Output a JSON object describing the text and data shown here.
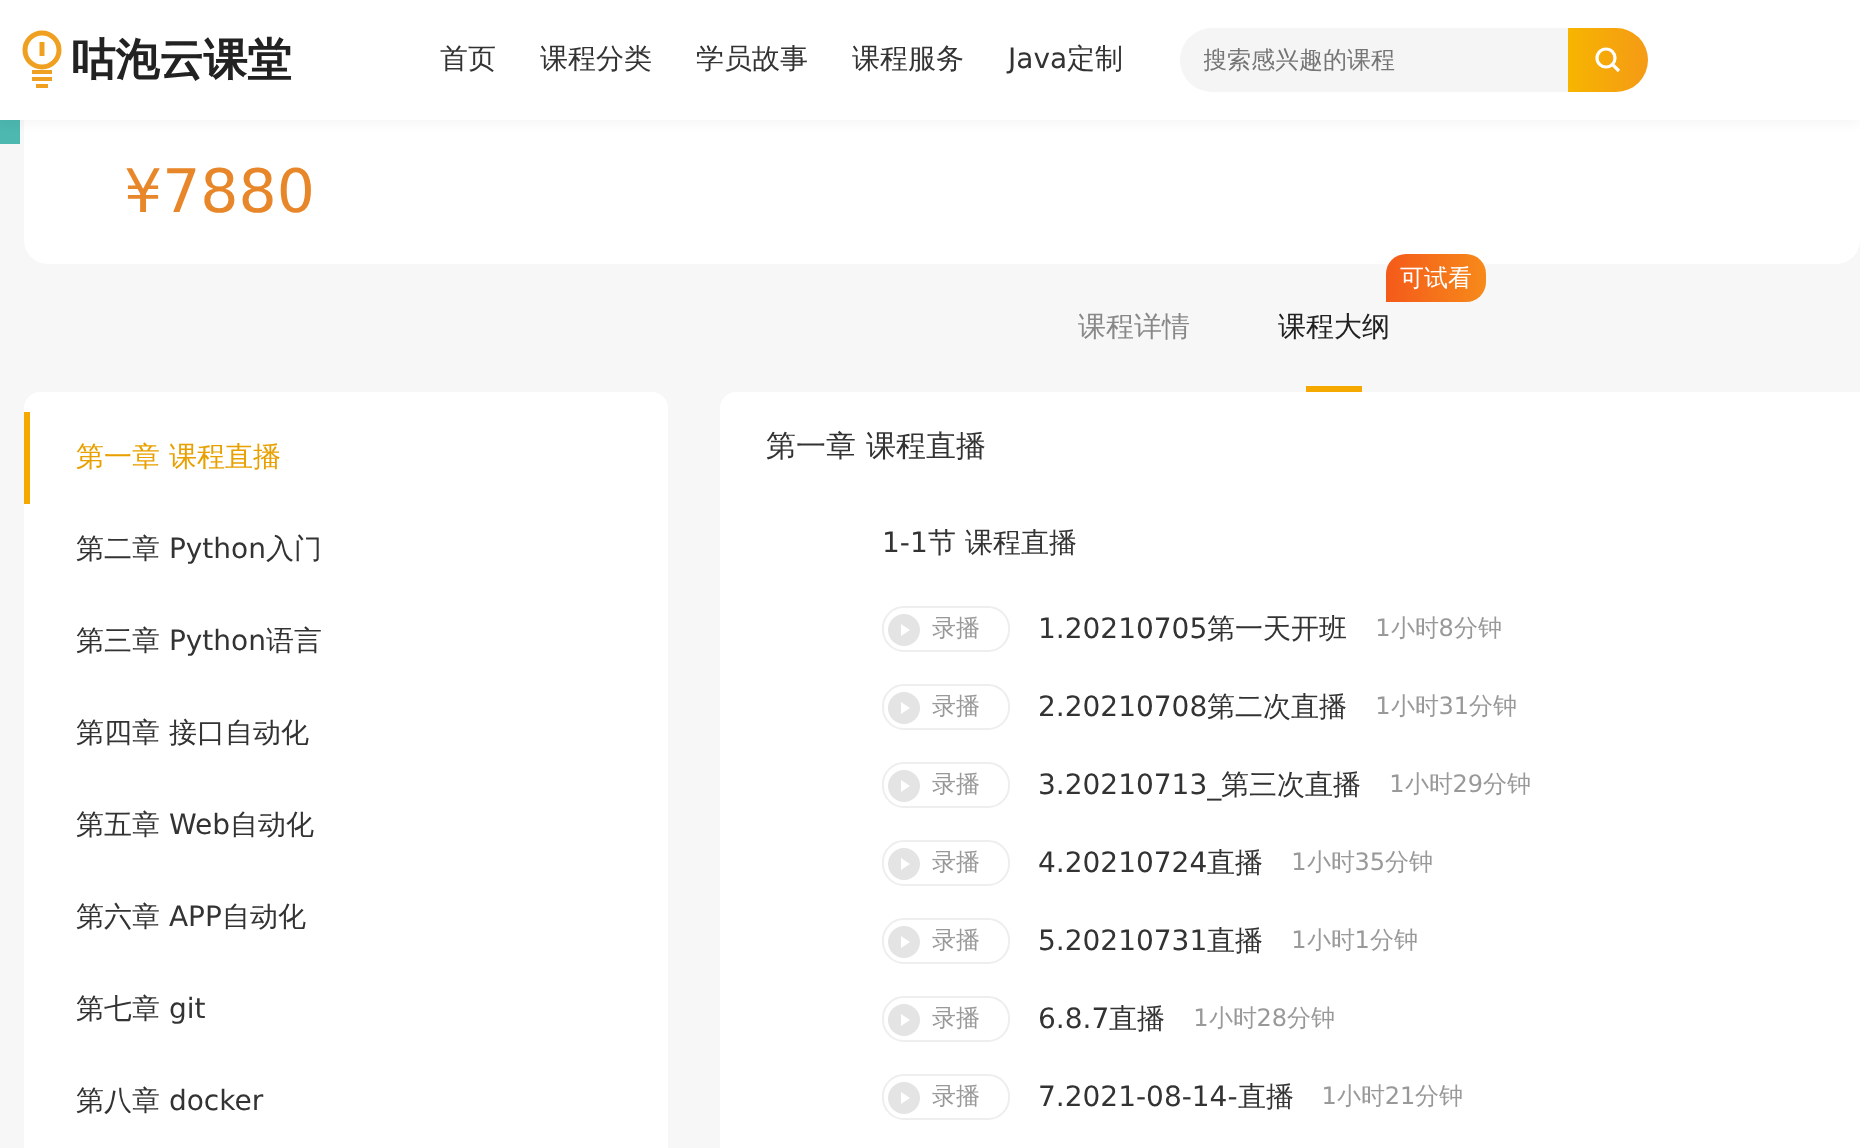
{
  "header": {
    "logo": "咕泡云课堂",
    "nav": [
      {
        "label": "首页"
      },
      {
        "label": "课程分类"
      },
      {
        "label": "学员故事"
      },
      {
        "label": "课程服务"
      },
      {
        "label": "Java定制"
      }
    ],
    "search": {
      "placeholder": "搜索感兴趣的课程"
    }
  },
  "price": "¥7880",
  "tabs": [
    {
      "label": "课程详情",
      "selected": false
    },
    {
      "label": "课程大纲",
      "selected": true,
      "badge": "可试看"
    }
  ],
  "chapters": [
    {
      "label": "第一章 课程直播",
      "selected": true
    },
    {
      "label": "第二章 Python入门",
      "selected": false
    },
    {
      "label": "第三章 Python语言",
      "selected": false
    },
    {
      "label": "第四章 接口自动化",
      "selected": false
    },
    {
      "label": "第五章 Web自动化",
      "selected": false
    },
    {
      "label": "第六章 APP自动化",
      "selected": false
    },
    {
      "label": "第七章 git",
      "selected": false
    },
    {
      "label": "第八章 docker",
      "selected": false
    }
  ],
  "outline": {
    "chapter_title": "第一章 课程直播",
    "section_title": "1-1节 课程直播",
    "lessons": [
      {
        "tag": "录播",
        "title": "1.20210705第一天开班",
        "duration": "1小时8分钟"
      },
      {
        "tag": "录播",
        "title": "2.20210708第二次直播",
        "duration": "1小时31分钟"
      },
      {
        "tag": "录播",
        "title": "3.20210713_第三次直播",
        "duration": "1小时29分钟"
      },
      {
        "tag": "录播",
        "title": "4.20210724直播",
        "duration": "1小时35分钟"
      },
      {
        "tag": "录播",
        "title": "5.20210731直播",
        "duration": "1小时1分钟"
      },
      {
        "tag": "录播",
        "title": "6.8.7直播",
        "duration": "1小时28分钟"
      },
      {
        "tag": "录播",
        "title": "7.2021-08-14-直播",
        "duration": "1小时21分钟"
      }
    ]
  }
}
